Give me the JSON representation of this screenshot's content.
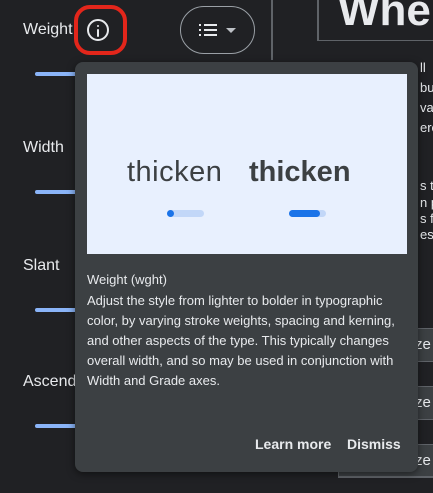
{
  "axes": {
    "items": [
      {
        "label": "Weight"
      },
      {
        "label": "Width"
      },
      {
        "label": "Slant"
      },
      {
        "label": "Ascender"
      }
    ]
  },
  "toolbar": {
    "info_icon": "info-icon",
    "view_icon": "list-view-icon",
    "view_caret": "chevron-down-icon"
  },
  "background": {
    "heading": "Whe",
    "fragments": [
      "ll",
      "bu",
      "vad",
      "ere",
      "s th",
      "n pu",
      "s fr",
      "esti"
    ],
    "size_buttons": [
      "ze",
      "ze",
      "ze"
    ]
  },
  "tooltip": {
    "preview": {
      "light_word": "thicken",
      "bold_word": "thicken",
      "slider_light_value": 0.2,
      "slider_bold_value": 0.85
    },
    "title": "Weight (wght)",
    "body": "Adjust the style from lighter to bolder in typographic color, by varying stroke weights, spacing and kerning, and other aspects of the type. This typically changes overall width, and so may be used in conjunction with Width and Grade axes.",
    "learn_more": "Learn more",
    "dismiss": "Dismiss"
  },
  "colors": {
    "accent": "#8ab4f8",
    "highlight": "#e3261b",
    "preview_bg": "#e8f0fe",
    "slider_blue": "#1a73e8"
  }
}
